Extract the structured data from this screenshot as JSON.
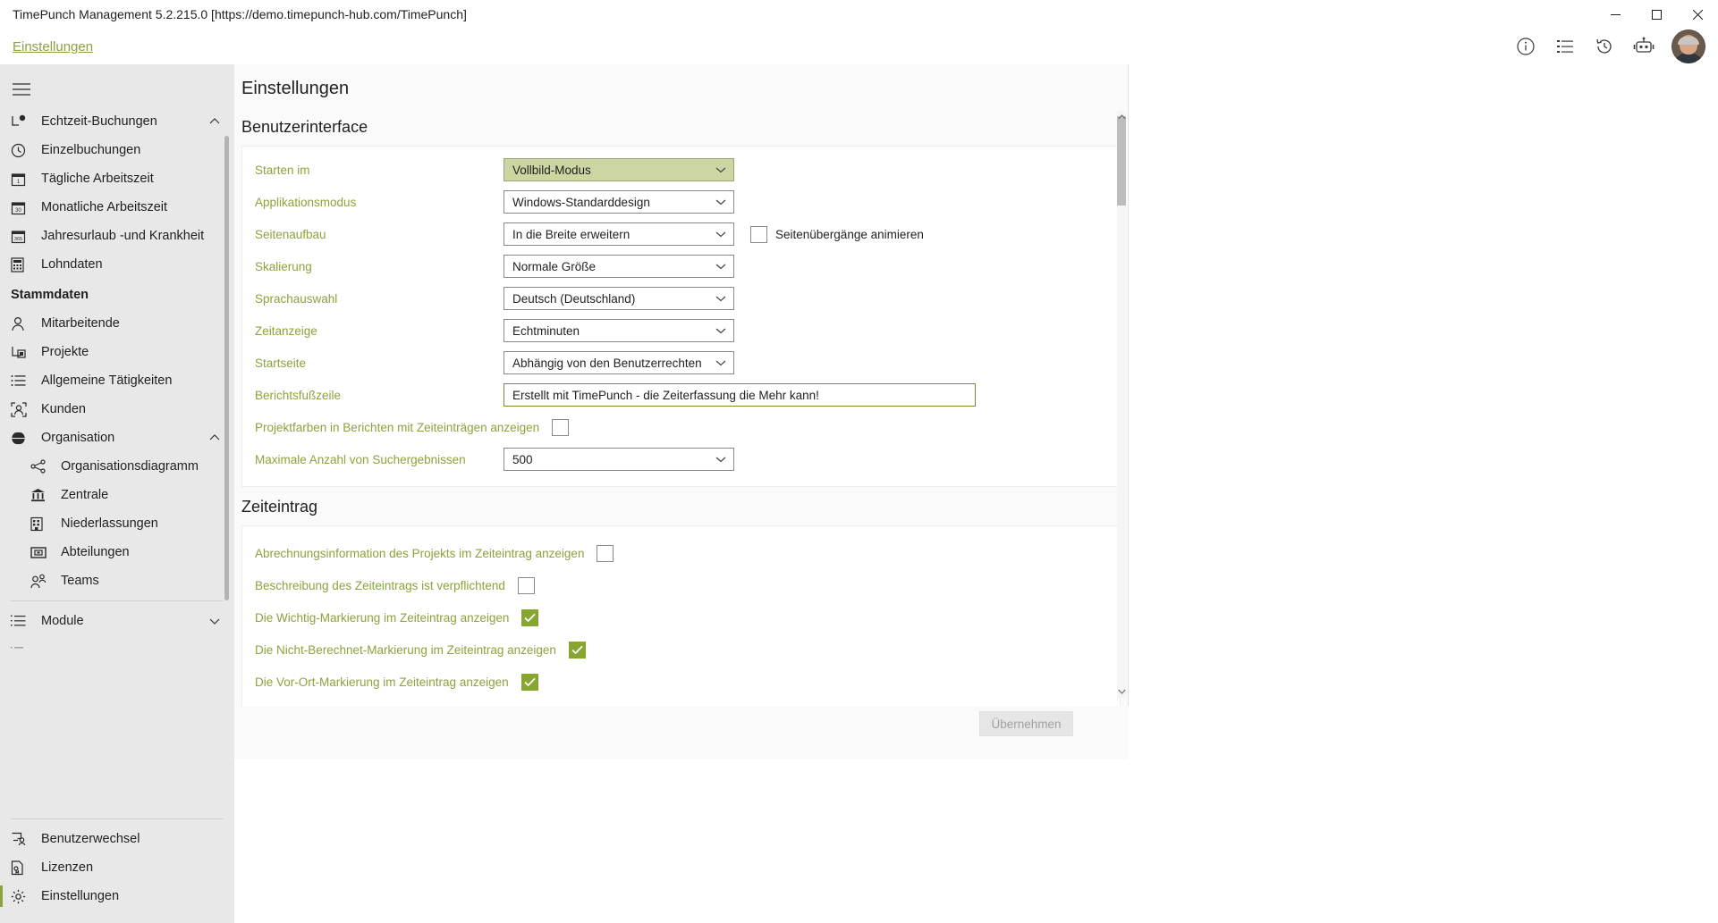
{
  "window": {
    "title": "TimePunch Management 5.2.215.0 [https://demo.timepunch-hub.com/TimePunch]",
    "minimize_label": "Minimieren",
    "maximize_label": "Maximieren",
    "close_label": "Schließen"
  },
  "header": {
    "breadcrumb": "Einstellungen",
    "icons": [
      {
        "name": "info-icon",
        "label": "Info"
      },
      {
        "name": "list-icon",
        "label": "Liste"
      },
      {
        "name": "history-icon",
        "label": "Verlauf"
      },
      {
        "name": "robot-icon",
        "label": "Assistent"
      }
    ]
  },
  "sidebar": {
    "menu_label": "Menü",
    "items": [
      {
        "label": "Echtzeit-Buchungen",
        "icon": "realtime-booking-icon",
        "expandable": true,
        "chevron": "⌃"
      },
      {
        "label": "Einzelbuchungen",
        "icon": "clock-icon"
      },
      {
        "label": "Tägliche Arbeitszeit",
        "icon": "calendar-day-icon"
      },
      {
        "label": "Monatliche Arbeitszeit",
        "icon": "calendar-month-icon"
      },
      {
        "label": "Jahresurlaub -und Krankheit",
        "icon": "calendar-year-icon"
      },
      {
        "label": "Lohndaten",
        "icon": "calculator-icon"
      }
    ],
    "group_title": "Stammdaten",
    "master_items": [
      {
        "label": "Mitarbeitende",
        "icon": "person-icon"
      },
      {
        "label": "Projekte",
        "icon": "project-icon"
      },
      {
        "label": "Allgemeine Tätigkeiten",
        "icon": "list-bullet-icon"
      },
      {
        "label": "Kunden",
        "icon": "customer-frame-icon"
      },
      {
        "label": "Organisation",
        "icon": "globe-icon",
        "expandable": true,
        "chevron": "⌃"
      }
    ],
    "org_children": [
      {
        "label": "Organisationsdiagramm",
        "icon": "org-chart-icon"
      },
      {
        "label": "Zentrale",
        "icon": "bank-icon"
      },
      {
        "label": "Niederlassungen",
        "icon": "building-icon"
      },
      {
        "label": "Abteilungen",
        "icon": "department-icon"
      },
      {
        "label": "Teams",
        "icon": "team-icon"
      }
    ],
    "modules": [
      {
        "label": "Module",
        "icon": "module-list-icon",
        "expandable": true,
        "chevron": "⌄"
      }
    ],
    "bottom_items": [
      {
        "label": "Benutzerwechsel",
        "icon": "switch-user-icon"
      },
      {
        "label": "Lizenzen",
        "icon": "license-icon"
      },
      {
        "label": "Einstellungen",
        "icon": "gear-icon",
        "active": true
      }
    ]
  },
  "main": {
    "page_title": "Einstellungen",
    "sections": [
      {
        "title": "Benutzerinterface",
        "rows": [
          {
            "type": "select",
            "label": "Starten im",
            "value": "Vollbild-Modus",
            "highlight": true
          },
          {
            "type": "select",
            "label": "Applikationsmodus",
            "value": "Windows-Standarddesign"
          },
          {
            "type": "select",
            "label": "Seitenaufbau",
            "value": "In die Breite erweitern",
            "extra_checkbox": {
              "label": "Seitenübergänge animieren",
              "checked": false
            }
          },
          {
            "type": "select",
            "label": "Skalierung",
            "value": "Normale Größe"
          },
          {
            "type": "select",
            "label": "Sprachauswahl",
            "value": "Deutsch (Deutschland)"
          },
          {
            "type": "select",
            "label": "Zeitanzeige",
            "value": "Echtminuten"
          },
          {
            "type": "select",
            "label": "Startseite",
            "value": "Abhängig von den Benutzerrechten"
          },
          {
            "type": "text",
            "label": "Berichtsfußzeile",
            "value": "Erstellt mit TimePunch - die Zeiterfassung die Mehr kann!"
          },
          {
            "type": "checkbox",
            "label": "Projektfarben in Berichten mit Zeiteinträgen anzeigen",
            "checked": false
          },
          {
            "type": "select",
            "label": "Maximale Anzahl von Suchergebnissen",
            "value": "500"
          }
        ]
      },
      {
        "title": "Zeiteintrag",
        "rows": [
          {
            "type": "checkbox",
            "label": "Abrechnungsinformation des Projekts im Zeiteintrag anzeigen",
            "checked": false
          },
          {
            "type": "checkbox",
            "label": "Beschreibung des Zeiteintrags ist verpflichtend",
            "checked": false
          },
          {
            "type": "checkbox",
            "label": "Die Wichtig-Markierung im Zeiteintrag anzeigen",
            "checked": true
          },
          {
            "type": "checkbox",
            "label": "Die Nicht-Berechnet-Markierung im Zeiteintrag anzeigen",
            "checked": true
          },
          {
            "type": "checkbox",
            "label": "Die Vor-Ort-Markierung im Zeiteintrag anzeigen",
            "checked": true
          }
        ]
      }
    ],
    "apply_button": "Übernehmen"
  },
  "colors": {
    "accent_green": "#8aa33c",
    "checkbox_green": "#86a62f",
    "highlight_bg": "#ccd6a2",
    "sidebar_bg": "#e8e8e8"
  }
}
